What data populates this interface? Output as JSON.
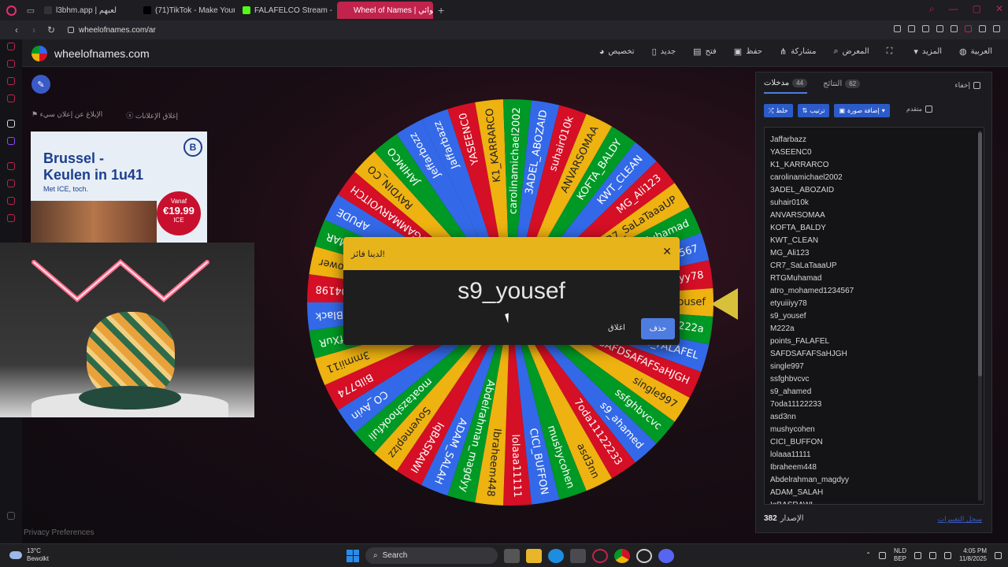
{
  "browser": {
    "tabs": [
      {
        "label": "l3bhm.app | لعبهم",
        "color": "#333"
      },
      {
        "label": "(71)TikTok - Make Your D",
        "color": "#000"
      },
      {
        "label": "FALAFELCO Stream - Wal",
        "color": "#53fc18"
      },
      {
        "label": "Wheel of Names | عشوائي",
        "color": "#c1234d",
        "active": true
      }
    ],
    "url": "wheelofnames.com/ar"
  },
  "site": {
    "title": "wheelofnames.com",
    "menu": [
      {
        "label": "العربية",
        "icon": "globe-icon"
      },
      {
        "label": "المزيد",
        "icon": "chevron-down-icon"
      },
      {
        "label": "",
        "icon": "fullscreen-icon"
      },
      {
        "label": "المعرض",
        "icon": "search-icon"
      },
      {
        "label": "مشاركة",
        "icon": "share-icon"
      },
      {
        "label": "حفظ",
        "icon": "save-icon"
      },
      {
        "label": "فتح",
        "icon": "folder-icon"
      },
      {
        "label": "جديد",
        "icon": "file-icon"
      },
      {
        "label": "تخصيص",
        "icon": "palette-icon"
      }
    ]
  },
  "ads": {
    "report_label": "الإبلاغ عن إعلان سيء",
    "close_ads_label": "إغلاق الإعلانات",
    "headline": "Brussel -\nKeulen in 1u41",
    "subline": "Met ICE, toch.",
    "logo": "B",
    "price_prefix": "Vanaf",
    "price": "€19.99",
    "price_suffix": "ICE"
  },
  "wheel": {
    "entries": [
      "Jaffarbazz",
      "YASEENC0",
      "K1_KARRARCO",
      "carolinamichael2002",
      "3ADEL_ABOZAID",
      "suhair010k",
      "ANVARSOMAA",
      "KOFTA_BALDY",
      "KWT_CLEAN",
      "MG_Ali123",
      "CR7_SaLaTaaaUP",
      "RTGMuhamad",
      "atro_mohamed1234567",
      "etyuiiiyy78",
      "s9_yousef",
      "M222a",
      "points_FALAFEL",
      "SAFDSAFAFSaHJGH",
      "single997",
      "ssfghbvcvc",
      "s9_ahamed",
      "7oda11122233",
      "asd3nn",
      "mushycohen",
      "CICI_BUFFON",
      "lolaaa11111",
      "Ibraheem448",
      "Abdelrahman_magdyy",
      "ADAM_SALAH",
      "IqBASRAWI",
      "Sovemeplzz",
      "moatazshookfuli",
      "CO_Avin",
      "Bilb774",
      "3mmii11",
      "L_OfXuR",
      "Black",
      "J0004198",
      "RodwanPower",
      "ALAMMAR",
      "APUDE",
      "RTGAMMARVOITCH",
      "RAYDIN_CO",
      "JAHIMCO",
      "Jeffarbozz"
    ],
    "colors": [
      "#3369e8",
      "#d50f25",
      "#eeb211",
      "#009925"
    ]
  },
  "dialog": {
    "title": "لدينا فائز!",
    "winner": "s9_yousef",
    "close_label": "اغلاق",
    "remove_label": "حذف"
  },
  "panel": {
    "tabs": [
      {
        "label": "مدخلات",
        "count": "44",
        "active": true
      },
      {
        "label": "النتائج",
        "count": "62",
        "active": false
      }
    ],
    "hide_label": "إخفاء",
    "shuffle_label": "خلط",
    "sort_label": "ترتيب",
    "image_label": "إضافة صورة",
    "advanced_label": "متقدم",
    "names": [
      "Jaffarbazz",
      "YASEENC0",
      "K1_KARRARCO",
      "carolinamichael2002",
      "3ADEL_ABOZAID",
      "suhair010k",
      "ANVARSOMAA",
      "KOFTA_BALDY",
      "KWT_CLEAN",
      "MG_Ali123",
      "CR7_SaLaTaaaUP",
      "RTGMuhamad",
      "atro_mohamed1234567",
      "etyuiiiyy78",
      "s9_yousef",
      "M222a",
      "points_FALAFEL",
      "SAFDSAFAFSaHJGH",
      "single997",
      "ssfghbvcvc",
      "s9_ahamed",
      "7oda11122233",
      "asd3nn",
      "mushycohen",
      "CICI_BUFFON",
      "lolaaa11111",
      "Ibraheem448",
      "Abdelrahman_magdyy",
      "ADAM_SALAH",
      "IqBASRAWI"
    ],
    "version_label": "الإصدار",
    "version": "382",
    "changelog_label": "سجل التغييرات"
  },
  "privacy_label": "Privacy Preferences",
  "taskbar": {
    "temp": "13°C",
    "weather": "Bewolkt",
    "search": "Search",
    "lang": "NLD",
    "lang2": "BEP",
    "time": "4:05 PM",
    "date": "11/8/2025"
  }
}
